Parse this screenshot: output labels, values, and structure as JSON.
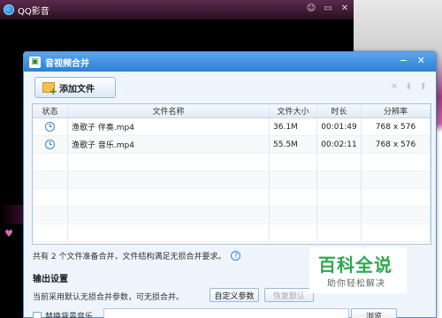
{
  "player": {
    "title": "QQ影音",
    "controls": [
      "skin-icon",
      "minimize-icon",
      "close-icon"
    ]
  },
  "dialog": {
    "title": "音视频合并",
    "add_button": "添加文件",
    "toolbar_icons": [
      "delete-icon",
      "move-down-icon",
      "move-up-icon"
    ],
    "columns": [
      "状态",
      "文件名称",
      "文件大小",
      "时长",
      "分辨率"
    ],
    "files": [
      {
        "name": "渔歌子 伴奏.mp4",
        "size": "36.1M",
        "duration": "00:01:49",
        "resolution": "768 x 576"
      },
      {
        "name": "渔歌子 音乐.mp4",
        "size": "55.5M",
        "duration": "00:02:11",
        "resolution": "768 x 576"
      }
    ],
    "summary": "共有 2 个文件准备合并，文件结构满足无损合并要求。",
    "output_section": "输出设置",
    "output_desc": "当前采用默认无损合并参数，可无损合并。",
    "custom_params_button": "自定义参数",
    "restore_default_button": "恢复默认",
    "bgm_label": "替换背景音乐",
    "browse_button": "浏览"
  },
  "watermark": {
    "title": "百科全说",
    "subtitle": "助你轻松解决"
  }
}
